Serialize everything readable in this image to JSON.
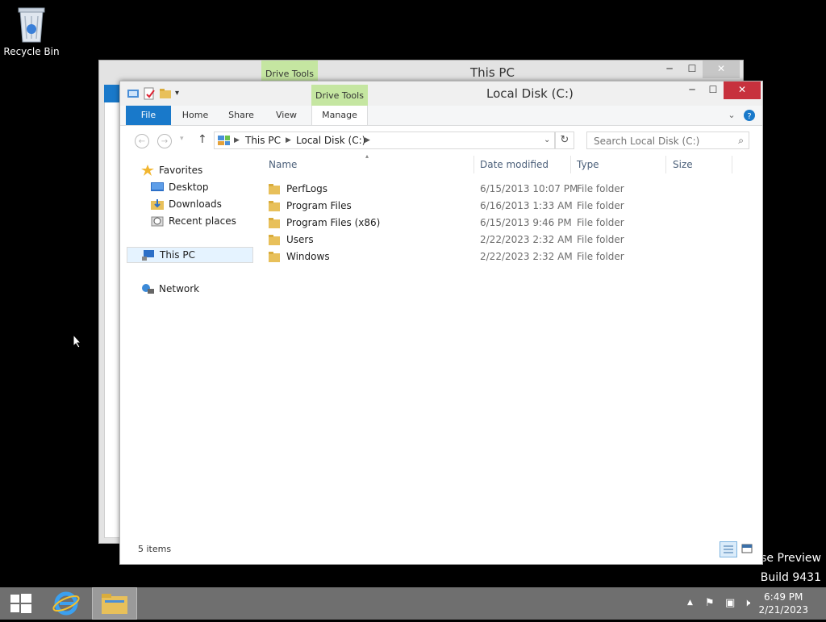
{
  "desktop": {
    "recycle_bin_label": "Recycle Bin",
    "watermark_line1": "ise Preview",
    "watermark_line2": "Build 9431"
  },
  "back_window": {
    "title": "This PC",
    "context_tab": "Drive Tools",
    "minimize": "─",
    "maximize": "☐",
    "close": "✕"
  },
  "window": {
    "title": "Local Disk (C:)",
    "context_tab": "Drive Tools",
    "minimize": "─",
    "maximize": "☐",
    "close": "✕",
    "ribbon_tabs": {
      "file": "File",
      "home": "Home",
      "share": "Share",
      "view": "View",
      "manage": "Manage"
    },
    "breadcrumb": {
      "this_pc": "This PC",
      "local_disk": "Local Disk (C:)"
    },
    "search_placeholder": "Search Local Disk (C:)",
    "nav": {
      "favorites": "Favorites",
      "desktop": "Desktop",
      "downloads": "Downloads",
      "recent": "Recent places",
      "this_pc": "This PC",
      "network": "Network"
    },
    "columns": {
      "name": "Name",
      "date": "Date modified",
      "type": "Type",
      "size": "Size"
    },
    "files": [
      {
        "name": "PerfLogs",
        "date": "6/15/2013 10:07 PM",
        "type": "File folder"
      },
      {
        "name": "Program Files",
        "date": "6/16/2013 1:33 AM",
        "type": "File folder"
      },
      {
        "name": "Program Files (x86)",
        "date": "6/15/2013 9:46 PM",
        "type": "File folder"
      },
      {
        "name": "Users",
        "date": "2/22/2023 2:32 AM",
        "type": "File folder"
      },
      {
        "name": "Windows",
        "date": "2/22/2023 2:32 AM",
        "type": "File folder"
      }
    ],
    "status_items": "5 items"
  },
  "taskbar": {
    "time": "6:49 PM",
    "date": "2/21/2023"
  },
  "colors": {
    "accent": "#1979ca",
    "context_tab": "#c5e6a1",
    "close": "#c7313d",
    "taskbar": "#6f6f6f"
  }
}
